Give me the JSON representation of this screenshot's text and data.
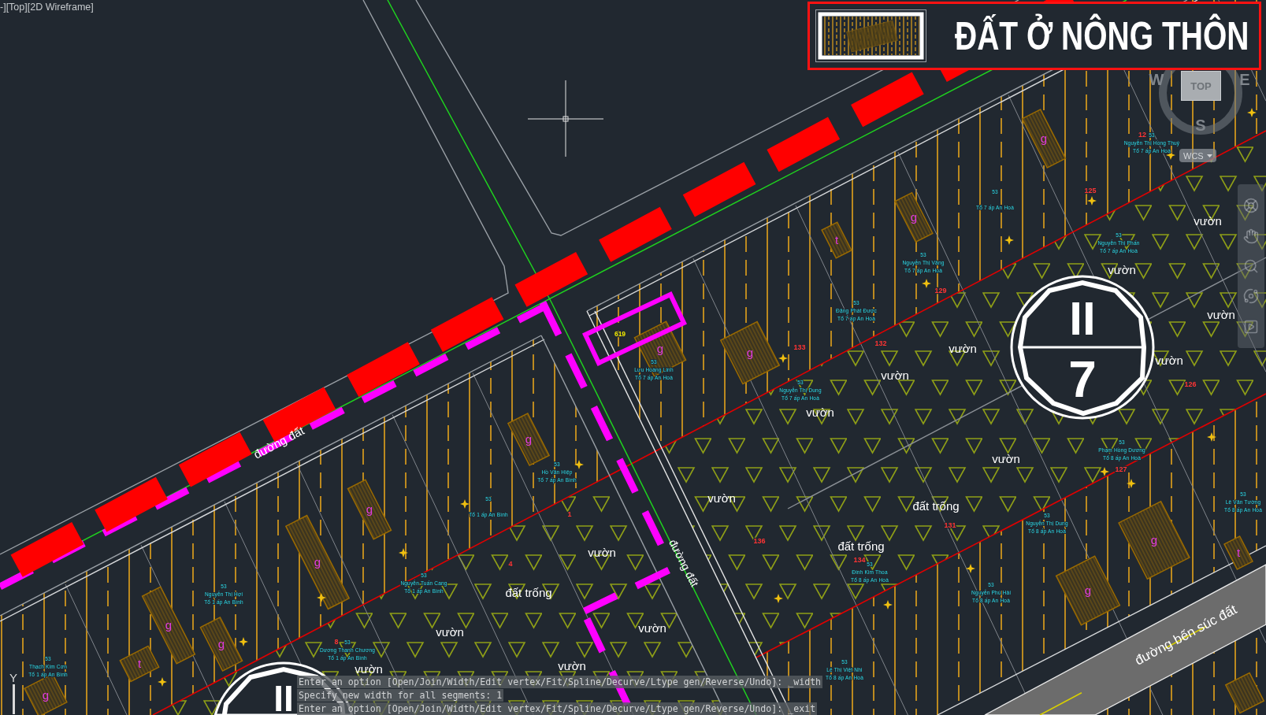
{
  "viewport_controls": {
    "label": "-][Top][2D Wireframe]"
  },
  "legend": {
    "title": "ĐẤT Ở NÔNG THÔN"
  },
  "view_cube": {
    "west": "W",
    "east": "E",
    "south": "S",
    "top": "TOP",
    "coordinate_system": "WCS"
  },
  "map": {
    "land_use_labels": [
      "vườn",
      "vườn",
      "vườn",
      "vườn",
      "vườn",
      "vườn",
      "vườn",
      "vườn",
      "vườn",
      "đất trống",
      "đất trống",
      "vườn",
      "đất trống",
      "vườn",
      "vườn",
      "vườn",
      "vườn"
    ],
    "road_labels": [
      "đường đất",
      "đường đất",
      "đường bến súc đất"
    ],
    "parcel_numbers": [
      "12",
      "125",
      "129",
      "132",
      "133",
      "136",
      "131",
      "134",
      "126",
      "127",
      "1",
      "4",
      "8"
    ],
    "lot_number": "619",
    "building_codes": [
      "g",
      "g",
      "t",
      "g",
      "g",
      "g",
      "g",
      "g",
      "g",
      "g",
      "t",
      "g",
      "g",
      "g",
      "t"
    ],
    "owners": [
      {
        "code": "53",
        "name": "Nguyễn Thị Hồng Thuý",
        "address": "Tổ 7 ấp An Hoà"
      },
      {
        "code": "53",
        "address": "Tổ 7 ấp An Hoà"
      },
      {
        "code": "53",
        "name": "Nguyễn Thị Vâng",
        "address": "Tổ 7 ấp An Hoà"
      },
      {
        "code": "53",
        "name": "Nguyễn Thị Phấn",
        "address": "Tổ 7 ấp An Hoà"
      },
      {
        "code": "53",
        "name": "Đặng Phát Được",
        "address": "Tổ 7 ấp An Hoà"
      },
      {
        "code": "53",
        "name": "Nguyễn Thị Dung",
        "address": "Tổ 7 ấp An Hoà"
      },
      {
        "code": "53",
        "name": "Lưu Hoàng Linh",
        "address": "Tổ 7 ấp An Hoà"
      },
      {
        "code": "53",
        "name": "Phạm Hồng Dương",
        "address": "Tổ 8 ấp An Hoà"
      },
      {
        "code": "53",
        "name": "Nguyễn Thị Dung",
        "address": "Tổ 8 ấp An Hoà"
      },
      {
        "code": "53",
        "name": "Đinh Kim Thoa",
        "address": "Tổ 8 ấp An Hoà"
      },
      {
        "code": "53",
        "name": "Nguyễn Phú Hải",
        "address": "Tổ 8 ấp An Hoà"
      },
      {
        "code": "53",
        "name": "Lê Văn Tường",
        "address": "Tổ 8 ấp An Hoà"
      },
      {
        "code": "53",
        "name": "Hồ Văn Hiệp",
        "address": "Tổ 7 ấp An Bình"
      },
      {
        "code": "53",
        "address": "Tổ 1 ấp An Bình"
      },
      {
        "code": "53",
        "name": "Nguyễn Thị Hợi",
        "address": "Tổ 1 ấp An Bình"
      },
      {
        "code": "53",
        "name": "Nguyễn Tuấn Cang",
        "address": "Tổ 1 ấp An Bình"
      },
      {
        "code": "53",
        "name": "Dương Thanh Chương",
        "address": "Tổ 1 ấp An Bình"
      },
      {
        "code": "53",
        "name": "Thạch Kim Cơn",
        "address": "Tổ 1 ấp An Bình"
      },
      {
        "code": "53",
        "name": "Lê Thị Việt Nhi",
        "address": "Tổ 8 ấp An Hoà"
      }
    ]
  },
  "zone_badges": [
    {
      "upper": "II",
      "lower": "7"
    },
    {
      "upper": "II"
    }
  ],
  "ucs_icon": {
    "axis": "Y"
  },
  "command_line": {
    "history": [
      "Enter an option [Open/Join/Width/Edit vertex/Fit/Spline/Decurve/Ltype gen/Reverse/Undo]: _width",
      "Specify new width for all segments: 1",
      "Enter an option [Open/Join/Width/Edit vertex/Fit/Spline/Decurve/Ltype gen/Reverse/Undo]: _exit"
    ]
  }
}
